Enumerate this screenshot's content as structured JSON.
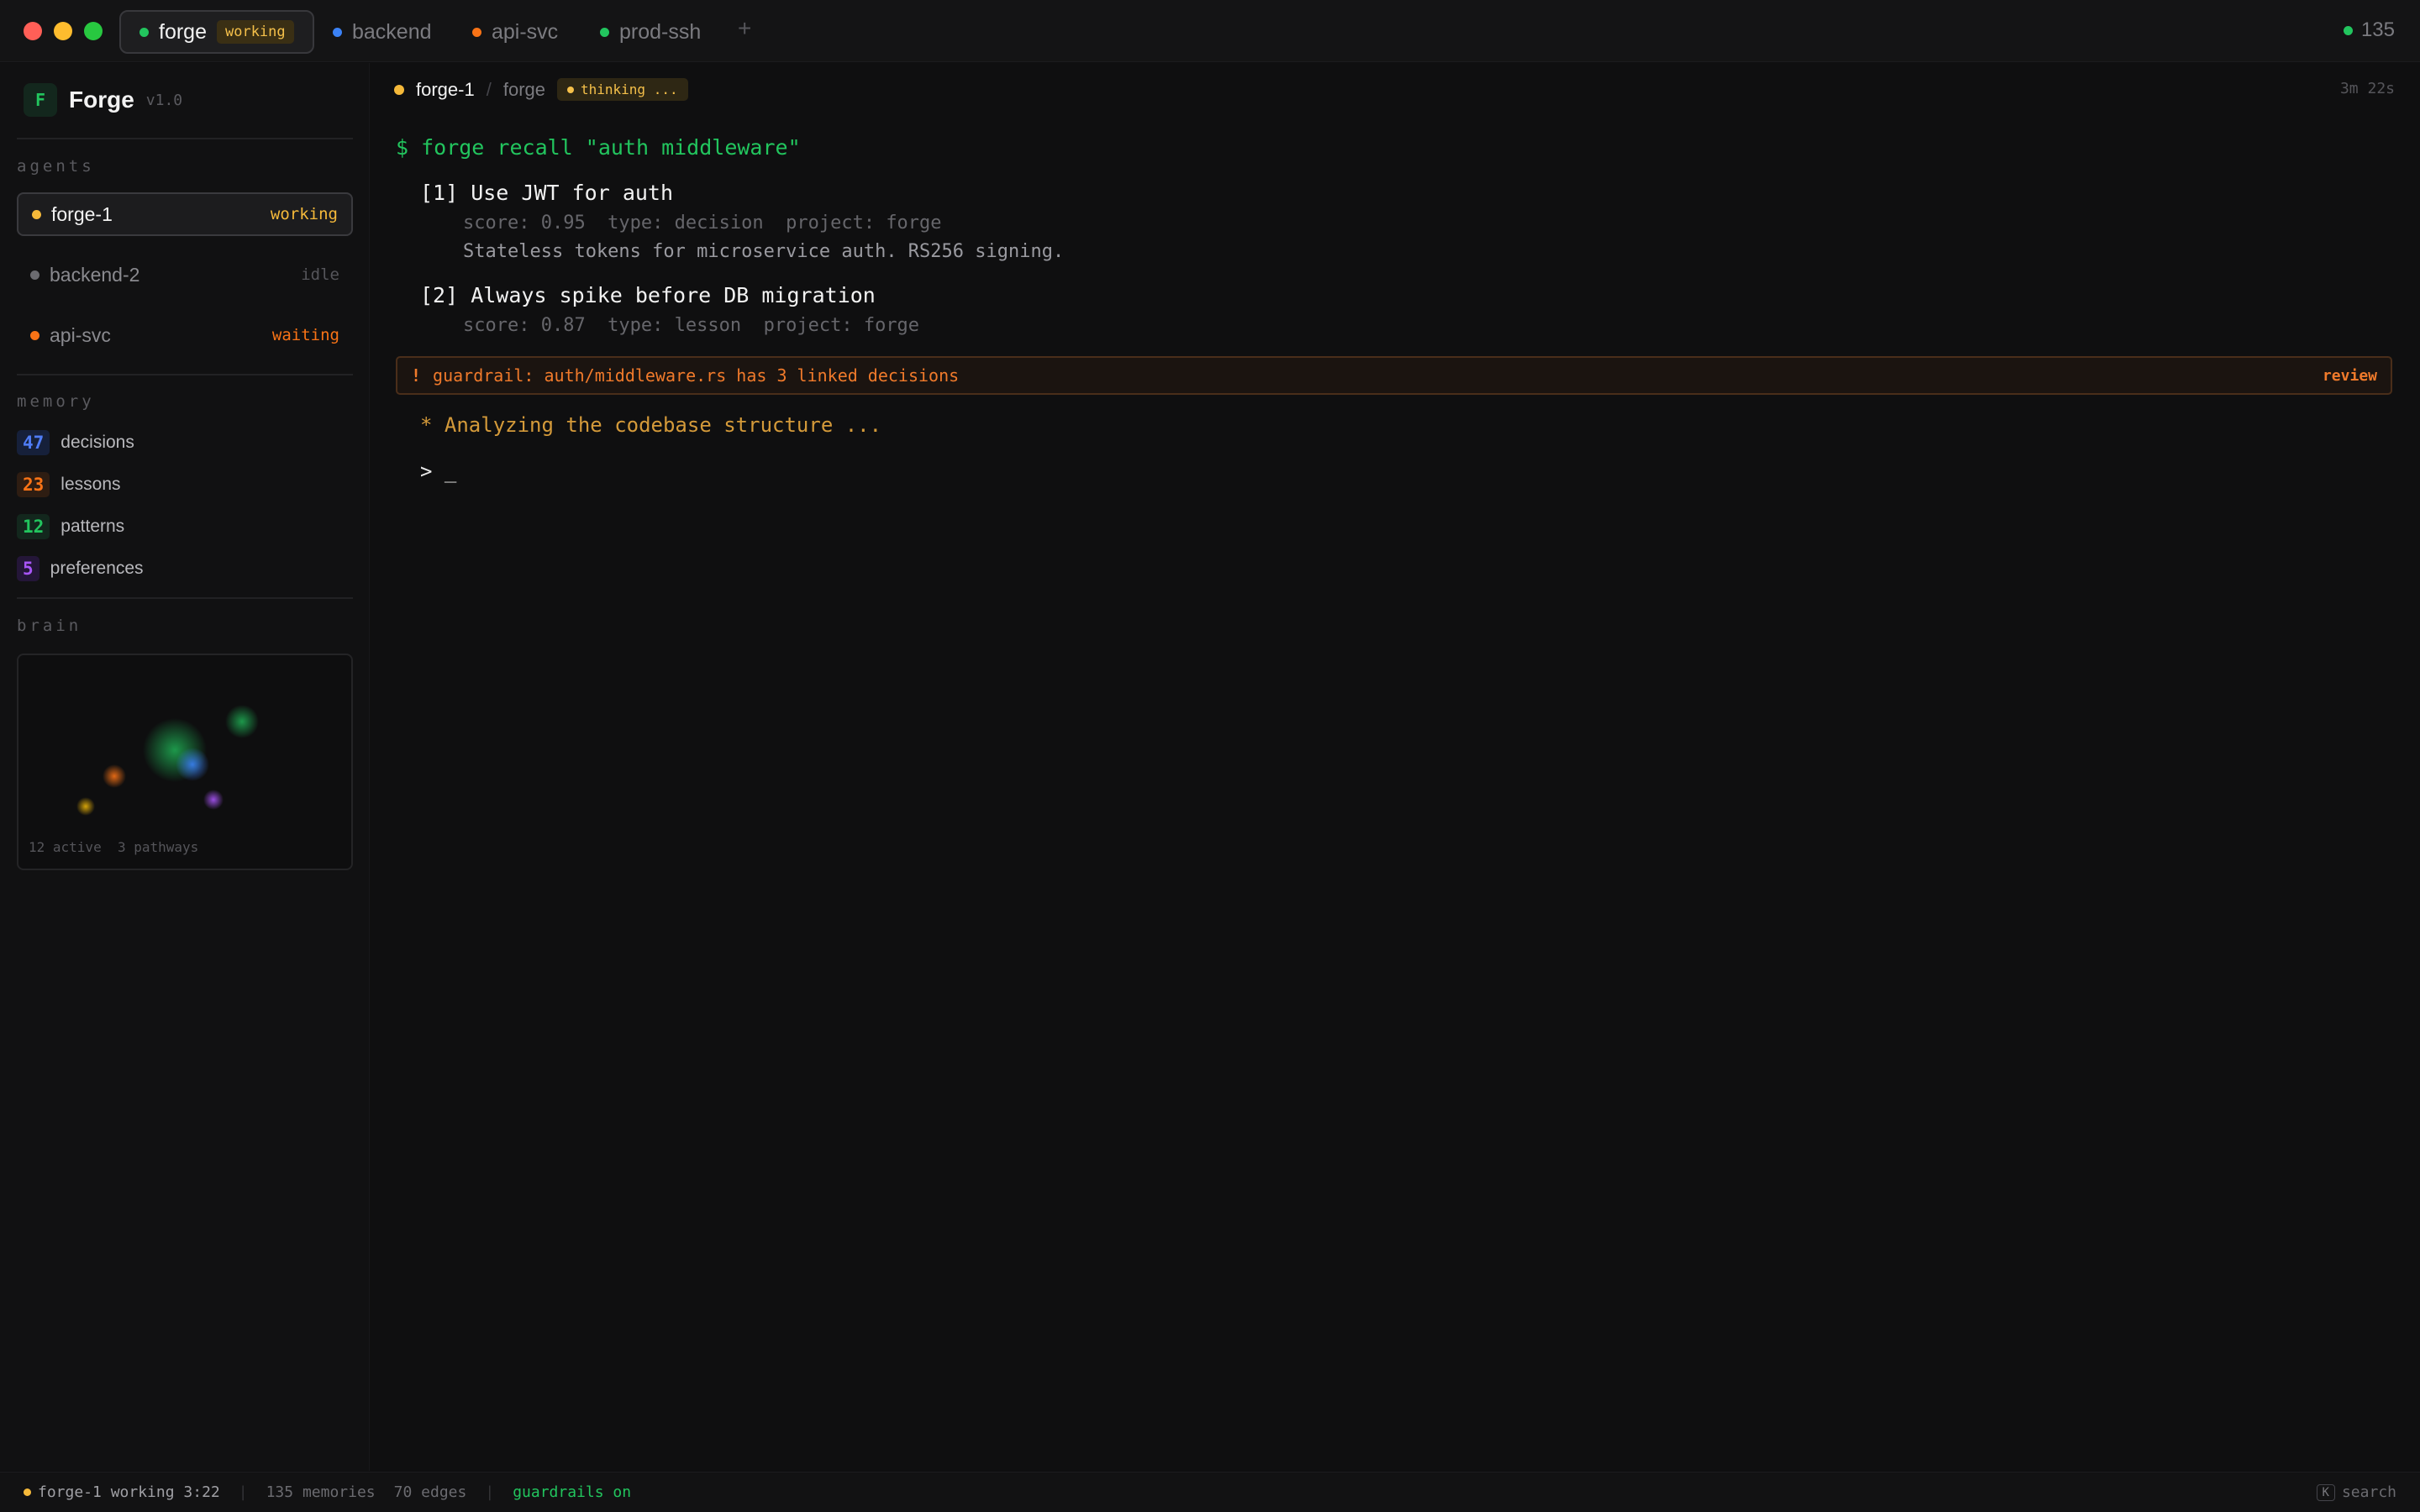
{
  "window": {
    "tabs": [
      {
        "label": "forge",
        "badge": "working",
        "color": "#22c55e"
      },
      {
        "label": "backend",
        "color": "#3b82f6"
      },
      {
        "label": "api-svc",
        "color": "#f97316"
      },
      {
        "label": "prod-ssh",
        "color": "#22c55e"
      }
    ],
    "add_tab": "+",
    "count": "135"
  },
  "sidebar": {
    "brand": {
      "logo": "F",
      "name": "Forge",
      "version": "v1.0"
    },
    "agents_label": "agents",
    "agents": [
      {
        "name": "forge-1",
        "status": "working",
        "color": "#f5b93a",
        "status_color": "#f5b93a"
      },
      {
        "name": "backend-2",
        "status": "idle",
        "color": "#6b6b70",
        "status_color": "#55555a"
      },
      {
        "name": "api-svc",
        "status": "waiting",
        "color": "#f97316",
        "status_color": "#f97316"
      }
    ],
    "memory_label": "memory",
    "memory": [
      {
        "count": "47",
        "label": "decisions",
        "color": "#4f7cf5",
        "bg": "#16203a"
      },
      {
        "count": "23",
        "label": "lessons",
        "color": "#f97316",
        "bg": "#2e1d12"
      },
      {
        "count": "12",
        "label": "patterns",
        "color": "#22c55e",
        "bg": "#13271d"
      },
      {
        "count": "5",
        "label": "preferences",
        "color": "#a855f7",
        "bg": "#241638"
      }
    ],
    "brain_label": "brain",
    "brain": {
      "active": "12 active",
      "pathways": "3 pathways"
    }
  },
  "main": {
    "agent": "forge-1",
    "project": "forge",
    "thinking": "thinking ...",
    "elapsed": "3m 22s",
    "command": "$ forge recall \"auth middleware\"",
    "results": [
      {
        "title": "[1] Use JWT for auth",
        "meta": "score: 0.95  type: decision  project: forge",
        "desc": "Stateless tokens for microservice auth. RS256 signing."
      },
      {
        "title": "[2] Always spike before DB migration",
        "meta": "score: 0.87  type: lesson  project: forge"
      }
    ],
    "guardrail": {
      "icon": "!",
      "text": "guardrail: auth/middleware.rs has 3 linked decisions",
      "action": "review"
    },
    "analyzing": "* Analyzing the codebase structure ...",
    "prompt": "> _"
  },
  "statusbar": {
    "agent_status": "forge-1 working 3:22",
    "memories": "135 memories",
    "edges": "70 edges",
    "guardrails": "guardrails on",
    "search_key": "K",
    "search_label": "search"
  }
}
